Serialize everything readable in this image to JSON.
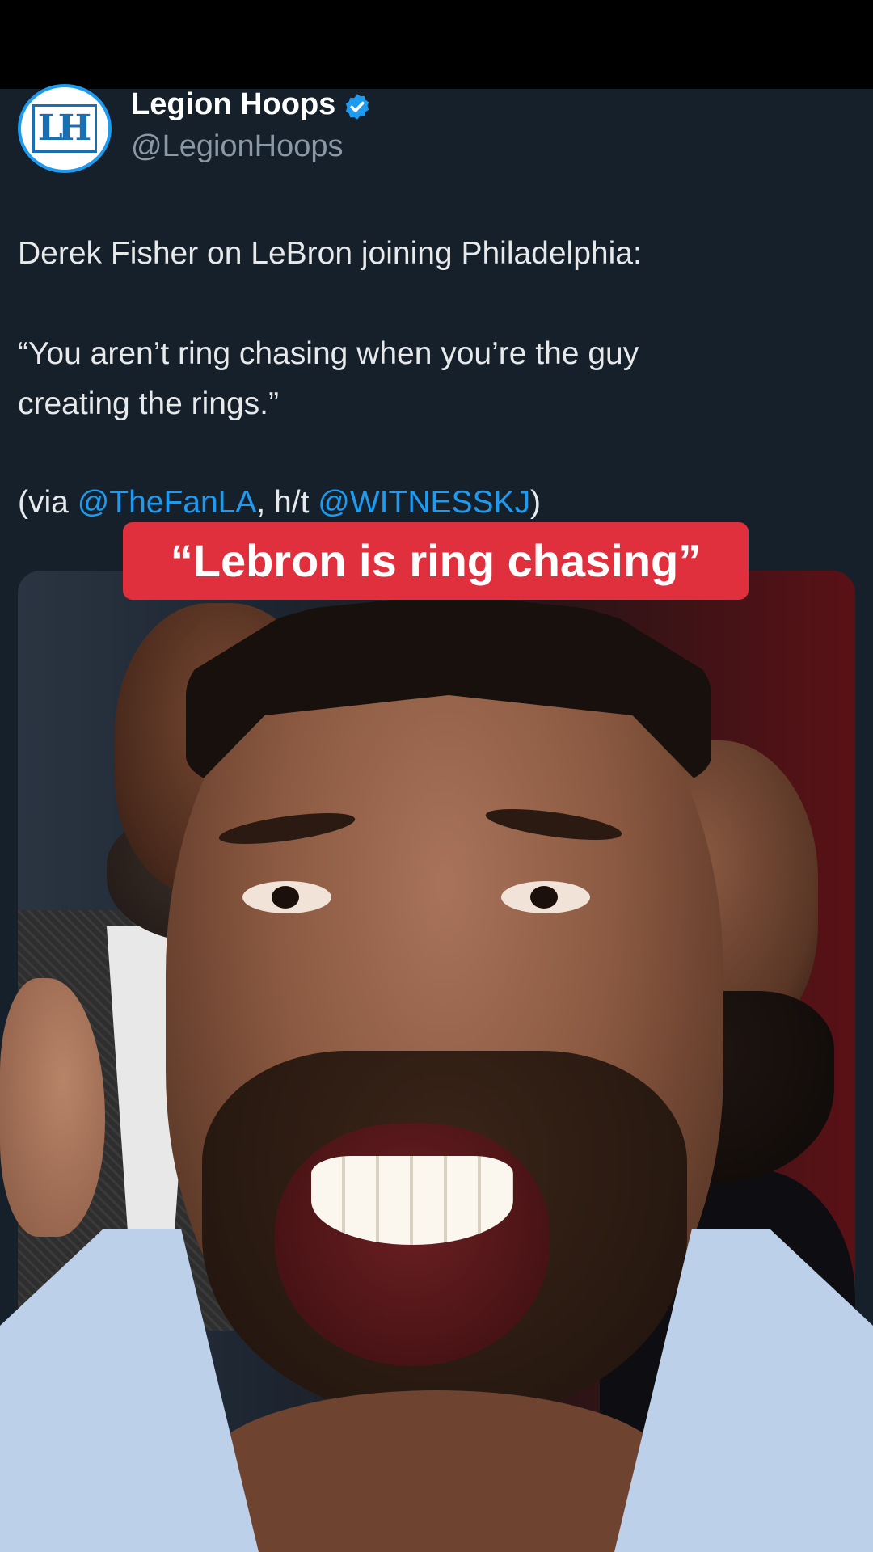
{
  "tweet": {
    "author": {
      "display_name": "Legion Hoops",
      "handle": "@LegionHoops",
      "verified": true,
      "avatar_letters": "LH"
    },
    "text": {
      "line1": "Derek Fisher on LeBron joining Philadelphia:",
      "line2": "“You aren’t ring chasing when you’re the guy",
      "line3": "creating the rings.”",
      "line4_prefix": "(via ",
      "mention1": "@TheFanLA",
      "line4_mid": ", h/t ",
      "mention2": "@WITNESSKJ",
      "line4_suffix": ")"
    }
  },
  "video": {
    "caption": "“Lebron is ring chasing”"
  },
  "colors": {
    "background": "#15202b",
    "text": "#e7e9ea",
    "muted": "#8b98a5",
    "link": "#1d9bf0",
    "caption_bg": "#e0303e"
  },
  "icons": [
    "verified-badge-icon"
  ]
}
